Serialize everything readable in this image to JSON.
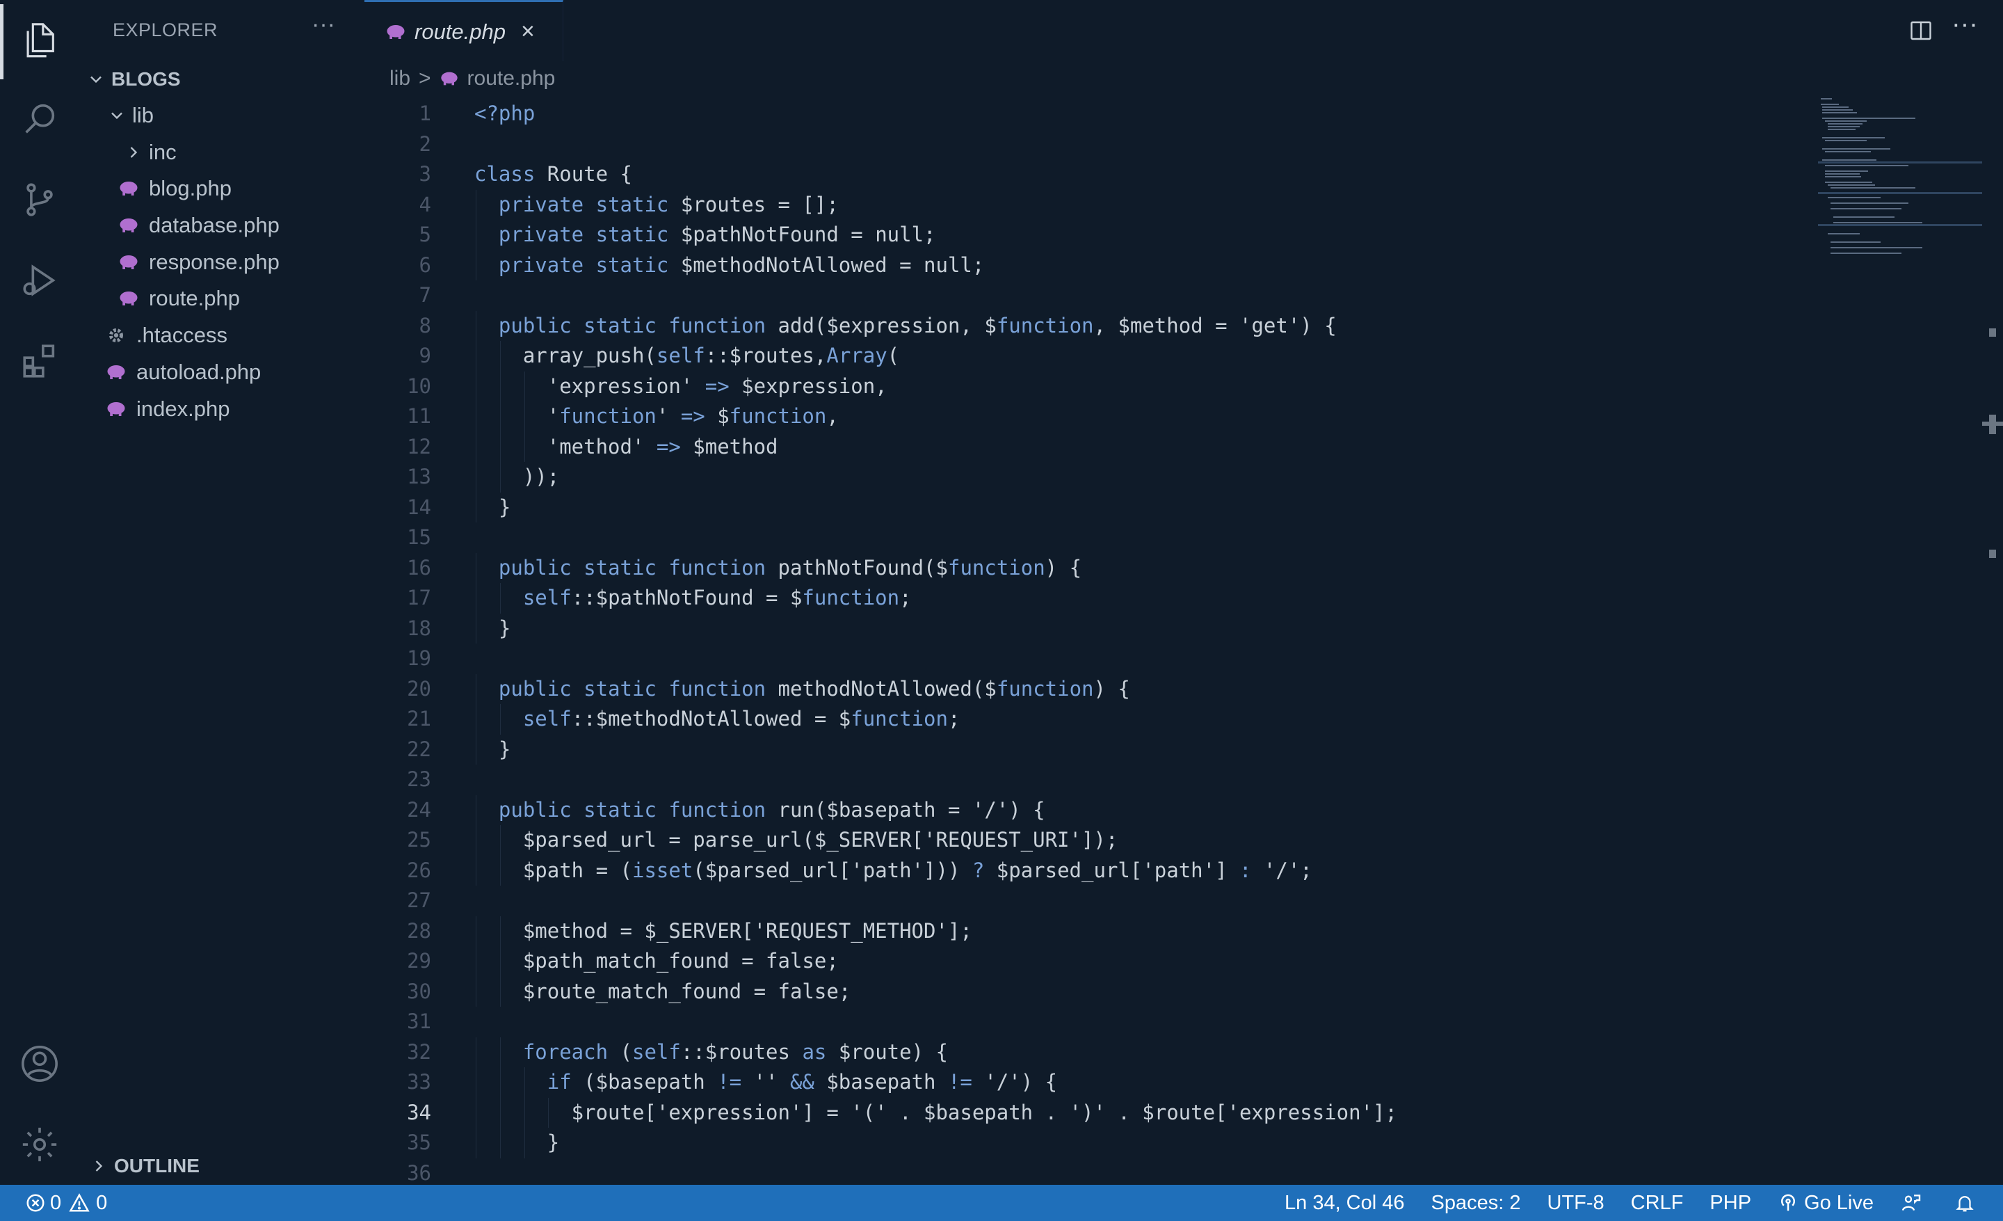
{
  "explorer": {
    "title": "EXPLORER",
    "more": "···",
    "workspace": "BLOGS",
    "items": [
      {
        "label": "lib",
        "type": "folder-open"
      },
      {
        "label": "inc",
        "type": "folder-closed"
      },
      {
        "label": "blog.php",
        "type": "php"
      },
      {
        "label": "database.php",
        "type": "php"
      },
      {
        "label": "response.php",
        "type": "php"
      },
      {
        "label": "route.php",
        "type": "php"
      },
      {
        "label": ".htaccess",
        "type": "config"
      },
      {
        "label": "autoload.php",
        "type": "php"
      },
      {
        "label": "index.php",
        "type": "php"
      }
    ],
    "outline": "OUTLINE"
  },
  "tab": {
    "label": "route.php",
    "close": "×"
  },
  "breadcrumb": {
    "folder": "lib",
    "sep": ">",
    "file": "route.php"
  },
  "editor": {
    "current_line": 34,
    "lines": [
      "<?php",
      "",
      "class Route {",
      "  private static $routes = [];",
      "  private static $pathNotFound = null;",
      "  private static $methodNotAllowed = null;",
      "",
      "  public static function add($expression, $function, $method = 'get') {",
      "    array_push(self::$routes,Array(",
      "      'expression' => $expression,",
      "      'function' => $function,",
      "      'method' => $method",
      "    ));",
      "  }",
      "",
      "  public static function pathNotFound($function) {",
      "    self::$pathNotFound = $function;",
      "  }",
      "",
      "  public static function methodNotAllowed($function) {",
      "    self::$methodNotAllowed = $function;",
      "  }",
      "",
      "  public static function run($basepath = '/') {",
      "    $parsed_url = parse_url($_SERVER['REQUEST_URI']);",
      "    $path = (isset($parsed_url['path'])) ? $parsed_url['path'] : '/';",
      "",
      "    $method = $_SERVER['REQUEST_METHOD'];",
      "    $path_match_found = false;",
      "    $route_match_found = false;",
      "",
      "    foreach (self::$routes as $route) {",
      "      if ($basepath != '' && $basepath != '/') {",
      "        $route['expression'] = '(' . $basepath . ')' . $route['expression'];",
      "      }",
      ""
    ]
  },
  "status": {
    "errors": "0",
    "warnings": "0",
    "position": "Ln 34, Col 46",
    "spaces": "Spaces: 2",
    "encoding": "UTF-8",
    "eol": "CRLF",
    "language": "PHP",
    "golive": "Go Live"
  },
  "colors": {
    "background": "#0f1b29",
    "statusbar": "#1f6fba",
    "keyword": "#7aa2d8",
    "php_icon": "#b06fcf"
  }
}
